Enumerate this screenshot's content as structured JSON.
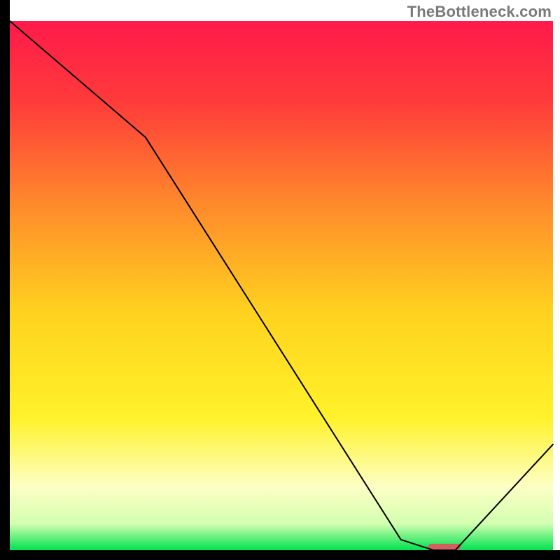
{
  "watermark": "TheBottleneck.com",
  "chart_data": {
    "type": "line",
    "title": "",
    "xlabel": "",
    "ylabel": "",
    "xlim": [
      0,
      100
    ],
    "ylim": [
      0,
      100
    ],
    "grid": false,
    "legend": false,
    "series": [
      {
        "name": "bottleneck-curve",
        "x": [
          0,
          25,
          72,
          78,
          82,
          100
        ],
        "y": [
          100,
          78,
          2,
          0,
          0,
          20
        ],
        "color": "#000000",
        "stroke_width": 2
      }
    ],
    "marker": {
      "name": "optimal-range",
      "x_center": 80,
      "width": 6,
      "y": 0,
      "height": 1.2,
      "color": "#d1605e",
      "rx": 4
    },
    "gradient_stops": [
      {
        "offset": 0.0,
        "color": "#ff1a4b"
      },
      {
        "offset": 0.15,
        "color": "#ff3a3a"
      },
      {
        "offset": 0.35,
        "color": "#ff8b2b"
      },
      {
        "offset": 0.55,
        "color": "#ffd21f"
      },
      {
        "offset": 0.75,
        "color": "#fff22a"
      },
      {
        "offset": 0.88,
        "color": "#fdffc4"
      },
      {
        "offset": 0.95,
        "color": "#d3ffb0"
      },
      {
        "offset": 1.0,
        "color": "#00e24f"
      }
    ],
    "axes": {
      "color": "#000000",
      "width": 14,
      "plot_inset": {
        "left": 14,
        "bottom": 14,
        "top": 30,
        "right": 10
      }
    }
  }
}
